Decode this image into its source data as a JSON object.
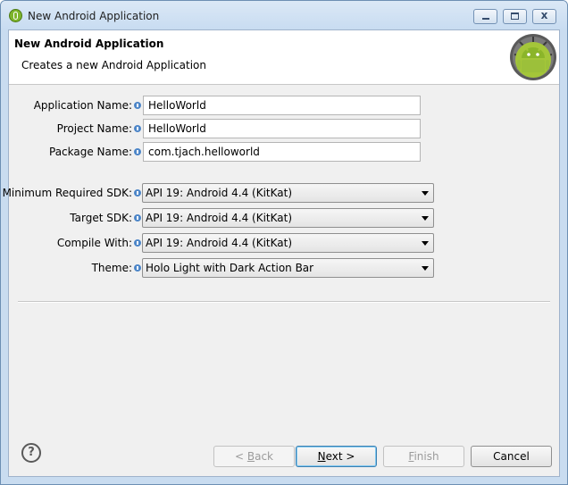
{
  "window": {
    "title": "New Android Application",
    "close_glyph": "x"
  },
  "banner": {
    "title": "New Android Application",
    "subtitle": "Creates a new Android Application"
  },
  "form": {
    "application_name": {
      "label": "Application Name:",
      "value": "HelloWorld"
    },
    "project_name": {
      "label": "Project Name:",
      "value": "HelloWorld"
    },
    "package_name": {
      "label": "Package Name:",
      "value": "com.tjach.helloworld"
    },
    "min_sdk": {
      "label": "Minimum Required SDK:",
      "value": "API 19: Android 4.4 (KitKat)"
    },
    "target_sdk": {
      "label": "Target SDK:",
      "value": "API 19: Android 4.4 (KitKat)"
    },
    "compile_with": {
      "label": "Compile With:",
      "value": "API 19: Android 4.4 (KitKat)"
    },
    "theme": {
      "label": "Theme:",
      "value": "Holo Light with Dark Action Bar"
    }
  },
  "footer": {
    "help": "?",
    "back": {
      "prefix": "< ",
      "mnemonic": "B",
      "rest": "ack"
    },
    "next": {
      "mnemonic": "N",
      "rest": "ext >"
    },
    "finish": {
      "mnemonic": "F",
      "rest": "inish"
    },
    "cancel": "Cancel"
  },
  "icons": {
    "app": "android-adt-icon",
    "badge": "android-robot-icon",
    "info": "info-icon",
    "help": "help-icon"
  },
  "colors": {
    "titlebar": "#c8dcf1",
    "client": "#f0f0f0",
    "android_green": "#8bc34a",
    "info_blue": "#4d86c8",
    "default_button_border": "#3c7fb1"
  }
}
